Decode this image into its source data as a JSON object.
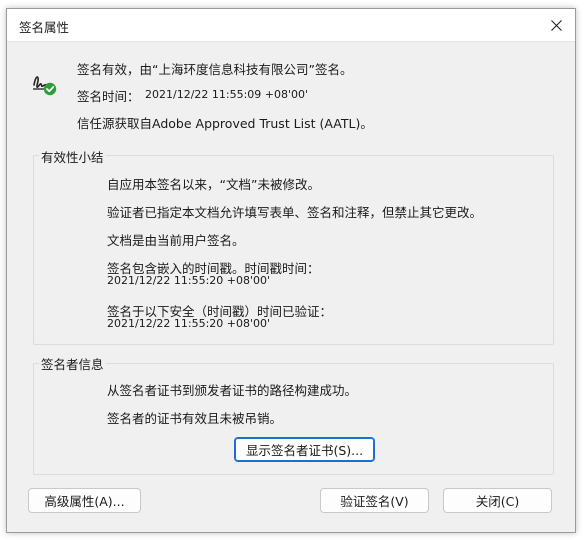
{
  "window": {
    "title": "签名属性"
  },
  "header": {
    "line1": "签名有效，由“上海环度信息科技有限公司”签名。",
    "time_label": "签名时间：",
    "time_value": "2021/12/22 11:55:09 +08'00'",
    "trust_line": "信任源获取自Adobe Approved Trust List (AATL)。",
    "icon": "signature-valid-icon",
    "icon_color": "#2e9e3d"
  },
  "validity": {
    "legend": "有效性小结",
    "line1": "自应用本签名以来，“文档”未被修改。",
    "line2": "验证者已指定本文档允许填写表单、签名和注释，但禁止其它更改。",
    "line3": "文档是由当前用户签名。",
    "line4": "签名包含嵌入的时间戳。时间戳时间：",
    "line4_value": "2021/12/22 11:55:20 +08'00'",
    "line5": "签名于以下安全（时间戳）时间已验证：",
    "line5_value": "2021/12/22 11:55:20 +08'00'"
  },
  "signer": {
    "legend": "签名者信息",
    "line1": "从签名者证书到颁发者证书的路径构建成功。",
    "line2": "签名者的证书有效且未被吊销。",
    "show_cert_button": "显示签名者证书(S)..."
  },
  "buttons": {
    "advanced": "高级属性(A)...",
    "validate": "验证签名(V)",
    "close": "关闭(C)"
  }
}
